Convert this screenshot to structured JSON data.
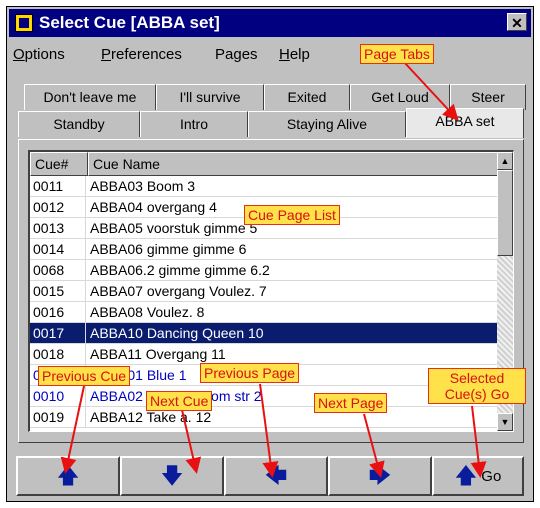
{
  "window": {
    "title": "Select Cue [ABBA set]",
    "close_glyph": "✕"
  },
  "menu": [
    {
      "first": "O",
      "rest": "ptions"
    },
    {
      "first": "P",
      "rest": "references"
    },
    {
      "first": "",
      "rest": "Pages"
    },
    {
      "first": "H",
      "rest": "elp"
    }
  ],
  "tabs_row1": [
    "Don't leave me",
    "I'll survive",
    "Exited",
    "Get Loud",
    "Steer"
  ],
  "tabs_row2": [
    "Standby",
    "Intro",
    "Staying Alive",
    "ABBA set"
  ],
  "active_tab": "ABBA set",
  "list": {
    "headers": [
      "Cue#",
      "Cue Name"
    ],
    "rows": [
      {
        "num": "0011",
        "name": "ABBA03 Boom 3",
        "style": ""
      },
      {
        "num": "0012",
        "name": "ABBA04 overgang 4",
        "style": ""
      },
      {
        "num": "0013",
        "name": "ABBA05 voorstuk gimme 5",
        "style": ""
      },
      {
        "num": "0014",
        "name": "ABBA06 gimme gimme  6",
        "style": ""
      },
      {
        "num": "0068",
        "name": "ABBA06.2 gimme gimme  6.2",
        "style": ""
      },
      {
        "num": "0015",
        "name": "ABBA07 overgang Voulez. 7",
        "style": ""
      },
      {
        "num": "0016",
        "name": "ABBA08 Voulez. 8",
        "style": ""
      },
      {
        "num": "0017",
        "name": "ABBA10 Dancing Queen 10",
        "style": "selected"
      },
      {
        "num": "0018",
        "name": "ABBA11 Overgang 11",
        "style": ""
      },
      {
        "num": "0009",
        "name": "ABBA01 Blue 1",
        "style": "blue"
      },
      {
        "num": "0010",
        "name": "ABBA02 Blue+random str 2",
        "style": "blue"
      },
      {
        "num": "0019",
        "name": "ABBA12 Take a. 12",
        "style": ""
      }
    ]
  },
  "scroll": {
    "up": "▲",
    "down": "▼"
  },
  "buttons": {
    "prev_cue": "🡅",
    "next_cue": "🡇",
    "prev_page": "🡄",
    "next_page": "🡆",
    "go_arrow": "🡅",
    "go_label": "Go"
  },
  "callouts": {
    "page_tabs": "Page Tabs",
    "cue_page_list": "Cue Page List",
    "previous_cue": "Previous Cue",
    "previous_page": "Previous Page",
    "next_cue": "Next Cue",
    "next_page": "Next Page",
    "selected_go_line1": "Selected",
    "selected_go_line2": "Cue(s) Go"
  },
  "colors": {
    "titlebar": "#000080",
    "selection": "#0a1c6e",
    "callout_bg": "#ffe24a",
    "callout_text": "#d81010",
    "arrow": "#e81010"
  }
}
